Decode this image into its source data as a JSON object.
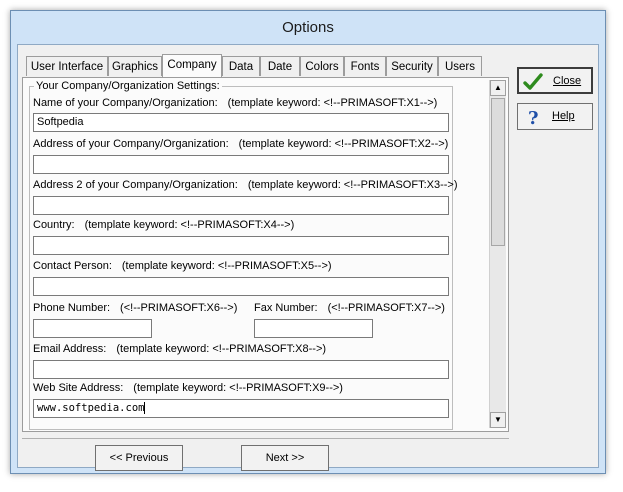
{
  "window": {
    "title": "Options"
  },
  "tabs": [
    {
      "label": "User Interface"
    },
    {
      "label": "Graphics"
    },
    {
      "label": "Company",
      "active": true
    },
    {
      "label": "Data"
    },
    {
      "label": "Date"
    },
    {
      "label": "Colors"
    },
    {
      "label": "Fonts"
    },
    {
      "label": "Security"
    },
    {
      "label": "Users"
    }
  ],
  "group": {
    "title": "Your Company/Organization Settings:"
  },
  "fields": {
    "name": {
      "label": "Name of your Company/Organization:",
      "keyword": "(template keyword: <!--PRIMASOFT:X1-->)",
      "value": "Softpedia"
    },
    "address": {
      "label": "Address of your Company/Organization:",
      "keyword": "(template keyword: <!--PRIMASOFT:X2-->)",
      "value": ""
    },
    "address2": {
      "label": "Address 2 of your Company/Organization:",
      "keyword": "(template keyword: <!--PRIMASOFT:X3-->)",
      "value": ""
    },
    "country": {
      "label": "Country:",
      "keyword": "(template keyword: <!--PRIMASOFT:X4-->)",
      "value": ""
    },
    "contact": {
      "label": "Contact Person:",
      "keyword": "(template keyword: <!--PRIMASOFT:X5-->)",
      "value": ""
    },
    "phone": {
      "label": "Phone Number:",
      "keyword": "(<!--PRIMASOFT:X6-->)",
      "value": ""
    },
    "fax": {
      "label": "Fax Number:",
      "keyword": "(<!--PRIMASOFT:X7-->)",
      "value": ""
    },
    "email": {
      "label": "Email Address:",
      "keyword": "(template keyword: <!--PRIMASOFT:X8-->)",
      "value": ""
    },
    "website": {
      "label": "Web Site Address:",
      "keyword": "(template keyword: <!--PRIMASOFT:X9-->)",
      "value": "www.softpedia.com"
    }
  },
  "buttons": {
    "close": {
      "label": "Close",
      "icon": "checkmark-icon",
      "color": "#2e8b1e"
    },
    "help": {
      "label": "Help",
      "icon": "question-icon",
      "color": "#1f4fa8"
    },
    "previous": {
      "label": "<< Previous"
    },
    "next": {
      "label": "Next >>"
    }
  }
}
